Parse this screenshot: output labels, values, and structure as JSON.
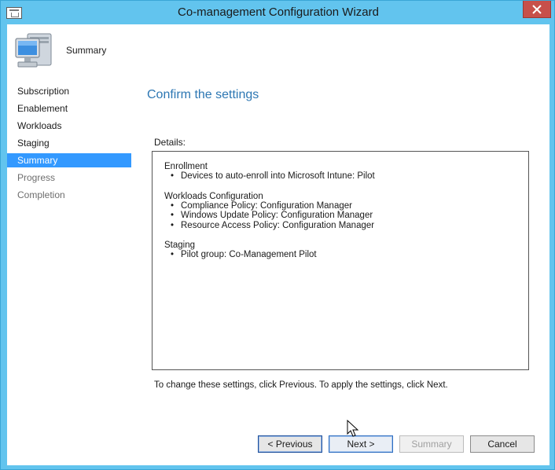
{
  "window": {
    "title": "Co-management Configuration Wizard"
  },
  "header": {
    "title": "Summary",
    "icon": "computer-monitor-icon"
  },
  "nav": {
    "items": [
      {
        "label": "Subscription",
        "state": "done"
      },
      {
        "label": "Enablement",
        "state": "done"
      },
      {
        "label": "Workloads",
        "state": "done"
      },
      {
        "label": "Staging",
        "state": "done"
      },
      {
        "label": "Summary",
        "state": "active"
      },
      {
        "label": "Progress",
        "state": "pending"
      },
      {
        "label": "Completion",
        "state": "pending"
      }
    ]
  },
  "main": {
    "heading": "Confirm the settings",
    "details_label": "Details:",
    "sections": [
      {
        "heading": "Enrollment",
        "items": [
          "Devices to auto-enroll into Microsoft Intune: Pilot"
        ]
      },
      {
        "heading": "Workloads Configuration",
        "items": [
          "Compliance Policy: Configuration Manager",
          "Windows Update Policy: Configuration Manager",
          "Resource Access Policy: Configuration Manager"
        ]
      },
      {
        "heading": "Staging",
        "items": [
          "Pilot group: Co-Management Pilot"
        ]
      }
    ],
    "instruction": "To change these settings, click Previous. To apply the settings, click Next."
  },
  "buttons": {
    "previous": "< Previous",
    "next": "Next >",
    "summary": "Summary",
    "cancel": "Cancel"
  },
  "colors": {
    "frame": "#62c4ee",
    "nav_selected": "#3399ff",
    "heading": "#2d77b3",
    "close": "#c7504a"
  }
}
